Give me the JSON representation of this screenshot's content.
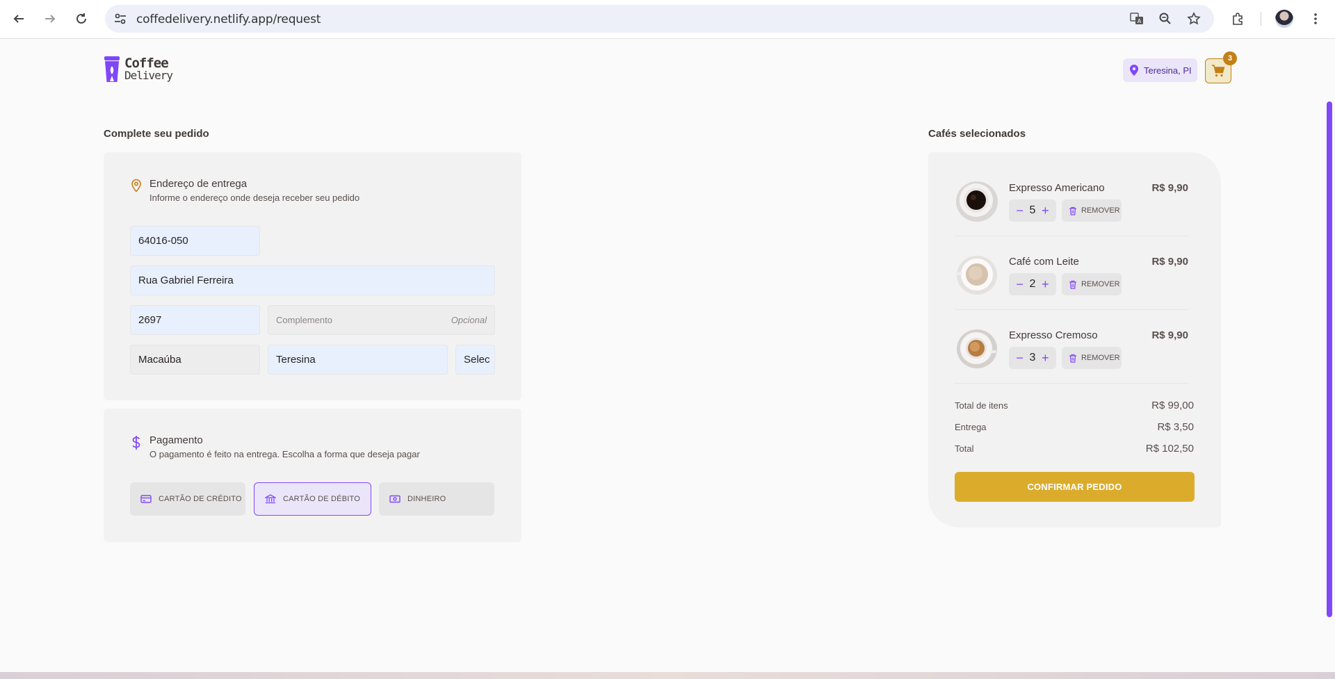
{
  "browser": {
    "url": "coffedelivery.netlify.app/request"
  },
  "header": {
    "logo_line1": "Coffee",
    "logo_line2": "Delivery",
    "location": "Teresina, PI",
    "cart_count": "3"
  },
  "order": {
    "title": "Complete seu pedido",
    "address": {
      "heading": "Endereço de entrega",
      "subheading": "Informe o endereço onde deseja receber seu pedido",
      "cep": "64016-050",
      "street": "Rua Gabriel Ferreira",
      "number": "2697",
      "complement_placeholder": "Complemento",
      "complement_optional": "Opcional",
      "neighborhood": "Macaúba",
      "city": "Teresina",
      "state": "Selec"
    },
    "payment": {
      "heading": "Pagamento",
      "subheading": "O pagamento é feito na entrega. Escolha a forma que deseja pagar",
      "options": [
        {
          "label": "CARTÃO DE CRÉDITO",
          "selected": false
        },
        {
          "label": "CARTÃO DE DÉBITO",
          "selected": true
        },
        {
          "label": "DINHEIRO",
          "selected": false
        }
      ]
    }
  },
  "summary": {
    "title": "Cafés selecionados",
    "items": [
      {
        "name": "Expresso Americano",
        "price": "R$ 9,90",
        "qty": "5",
        "remove": "REMOVER"
      },
      {
        "name": "Café com Leite",
        "price": "R$ 9,90",
        "qty": "2",
        "remove": "REMOVER"
      },
      {
        "name": "Expresso Cremoso",
        "price": "R$ 9,90",
        "qty": "3",
        "remove": "REMOVER"
      }
    ],
    "total_items_label": "Total de itens",
    "total_items_value": "R$ 99,00",
    "delivery_label": "Entrega",
    "delivery_value": "R$ 3,50",
    "total_label": "Total",
    "total_value": "R$ 102,50",
    "confirm_label": "CONFIRMAR PEDIDO"
  },
  "colors": {
    "purple": "#8047f8",
    "purple_dark": "#4b2995",
    "yellow": "#dbac2c",
    "yellow_dark": "#c47f17"
  }
}
